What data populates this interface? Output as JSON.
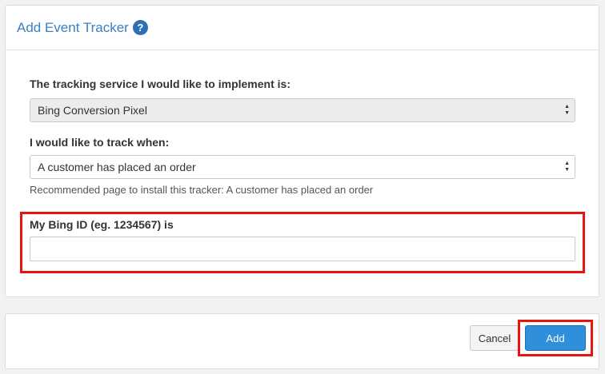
{
  "header": {
    "title": "Add Event Tracker",
    "help_glyph": "?"
  },
  "form": {
    "service_label": "The tracking service I would like to implement is:",
    "service_value": "Bing Conversion Pixel",
    "track_when_label": "I would like to track when:",
    "track_when_value": "A customer has placed an order",
    "recommended_text": "Recommended page to install this tracker: A customer has placed an order",
    "bing_id_label": "My Bing ID (eg. 1234567) is",
    "bing_id_value": ""
  },
  "footer": {
    "cancel_label": "Cancel",
    "add_label": "Add"
  },
  "colors": {
    "accent": "#3a7fc4",
    "primary_button": "#2f8fdb",
    "highlight": "#e8140d"
  },
  "icons": {
    "help": "help-circle-icon",
    "select_arrows": "updown-arrows-icon"
  }
}
